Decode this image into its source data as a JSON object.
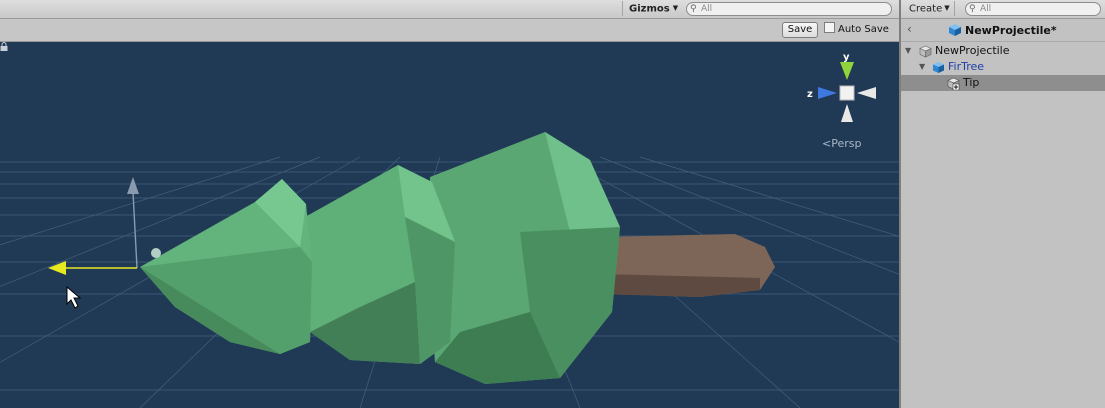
{
  "scene": {
    "toolbar": {
      "gizmos_label": "Gizmos",
      "search_placeholder": "All"
    },
    "prefab_bar": {
      "save_label": "Save",
      "autosave_label": "Auto Save",
      "autosave_checked": false
    },
    "gizmo": {
      "axis_y": "y",
      "axis_z": "z",
      "projection_label": "Persp"
    },
    "colors": {
      "background": "#203a55",
      "grid": "#5a7896",
      "tree_foliage": "#5fb07a",
      "trunk": "#7d6658",
      "handle_x": "#e8e820",
      "axis_y": "#8fd43a",
      "axis_z": "#3f78e0"
    }
  },
  "hierarchy": {
    "toolbar": {
      "create_label": "Create",
      "search_placeholder": "All"
    },
    "title": "NewProjectile*",
    "items": [
      {
        "label": "NewProjectile",
        "type": "root",
        "expanded": true,
        "selected": false
      },
      {
        "label": "FirTree",
        "type": "prefab",
        "expanded": true,
        "selected": false
      },
      {
        "label": "Tip",
        "type": "child",
        "expanded": false,
        "selected": true
      }
    ]
  }
}
